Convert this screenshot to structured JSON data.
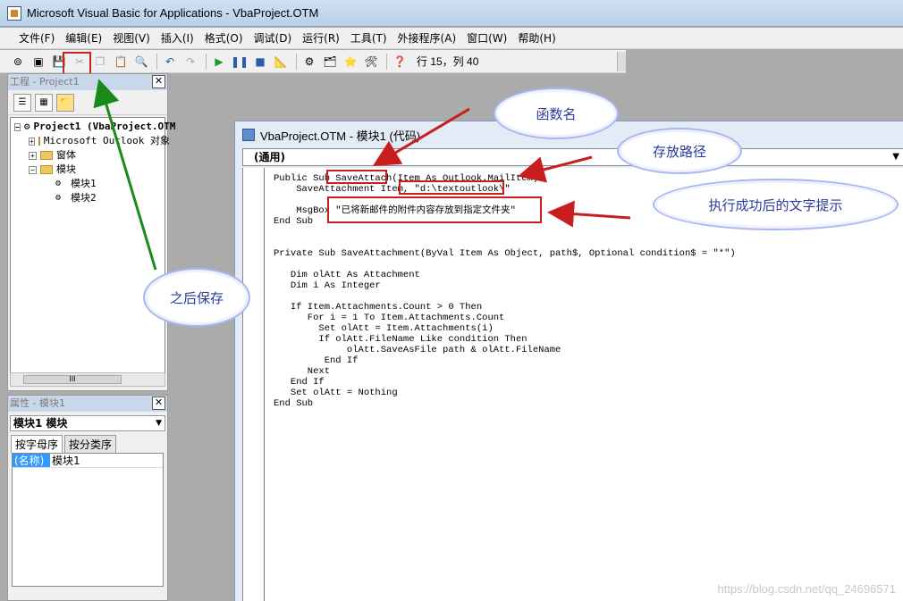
{
  "window": {
    "title": "Microsoft Visual Basic for Applications - VbaProject.OTM"
  },
  "menu": [
    "文件(F)",
    "编辑(E)",
    "视图(V)",
    "插入(I)",
    "格式(O)",
    "调试(D)",
    "运行(R)",
    "工具(T)",
    "外接程序(A)",
    "窗口(W)",
    "帮助(H)"
  ],
  "toolbar": {
    "position": "行 15，列 40"
  },
  "project": {
    "title": "工程 - Project1",
    "close": "✕",
    "tree": [
      {
        "label": "Project1 (VbaProject.OTM)",
        "toggle": "−"
      },
      {
        "label": "Microsoft Outlook 对象",
        "toggle": "+"
      },
      {
        "label": "窗体",
        "toggle": "+"
      },
      {
        "label": "模块",
        "toggle": "−"
      },
      {
        "label": "模块1"
      },
      {
        "label": "模块2"
      }
    ],
    "scroll_thumb": "III"
  },
  "properties": {
    "title": "属性 - 模块1",
    "close": "✕",
    "object": "模块1 模块",
    "tabs": [
      "按字母序",
      "按分类序"
    ],
    "rows": [
      {
        "key": "(名称)",
        "value": "模块1"
      }
    ]
  },
  "code_window": {
    "title": "VbaProject.OTM - 模块1 (代码)",
    "procedure": "(通用)",
    "lines": [
      "Public Sub SaveAttach(Item As Outlook.MailItem)",
      "    SaveAttachment Item, \"d:\\textoutlook\\\"",
      "",
      "    MsgBox \"已将新邮件的附件内容存放到指定文件夹\"",
      "End Sub",
      "",
      "",
      "Private Sub SaveAttachment(ByVal Item As Object, path$, Optional condition$ = \"*\")",
      "",
      "   Dim olAtt As Attachment",
      "   Dim i As Integer",
      "",
      "   If Item.Attachments.Count > 0 Then",
      "      For i = 1 To Item.Attachments.Count",
      "        Set olAtt = Item.Attachments(i)",
      "        If olAtt.FileName Like condition Then",
      "             olAtt.SaveAsFile path & olAtt.FileName",
      "         End If",
      "      Next",
      "   End If",
      "   Set olAtt = Nothing",
      "End Sub"
    ]
  },
  "annotations": {
    "function_name": "函数名",
    "save_path": "存放路径",
    "success_text": "执行成功后的文字提示",
    "save_after": "之后保存"
  },
  "watermark": "https://blog.csdn.net/qq_24696571",
  "colors": {
    "annotation_red": "#c81e1e",
    "annotation_green": "#1a8a1a",
    "cloud_text": "#2a3a9c"
  }
}
